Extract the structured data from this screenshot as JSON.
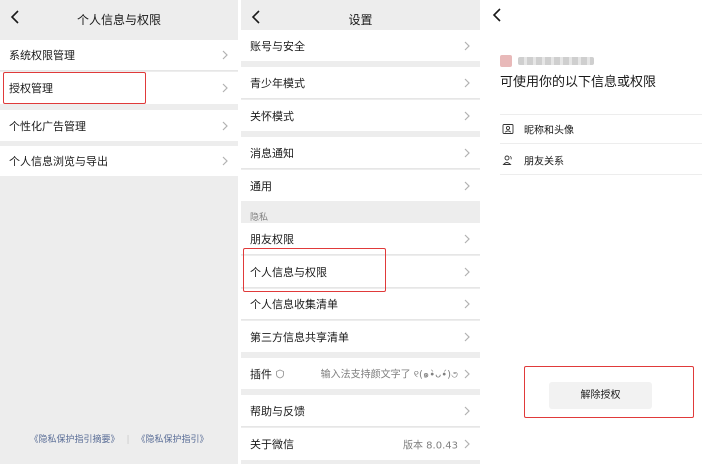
{
  "panel1": {
    "title": "个人信息与权限",
    "items": [
      {
        "label": "系统权限管理"
      },
      {
        "label": "授权管理"
      },
      {
        "label": "个性化广告管理"
      },
      {
        "label": "个人信息浏览与导出"
      }
    ],
    "footer_links": [
      "《隐私保护指引摘要》",
      "《隐私保护指引》"
    ]
  },
  "panel2": {
    "title": "设置",
    "items": [
      {
        "label": "账号与安全"
      },
      {
        "label": "青少年模式"
      },
      {
        "label": "关怀模式"
      },
      {
        "label": "消息通知"
      },
      {
        "label": "通用"
      },
      {
        "label": "朋友权限"
      },
      {
        "label": "个人信息与权限"
      },
      {
        "label": "个人信息收集清单"
      },
      {
        "label": "第三方信息共享清单"
      },
      {
        "label": "插件",
        "value": "输入法支持颜文字了 ୧(๑•̀ᴗ•́)૭"
      },
      {
        "label": "帮助与反馈"
      },
      {
        "label": "关于微信",
        "value": "版本 8.0.43"
      }
    ],
    "section_label": "隐私"
  },
  "panel3": {
    "heading": "可使用你的以下信息或权限",
    "permissions": [
      {
        "label": "昵称和头像",
        "icon": "id-card-icon"
      },
      {
        "label": "朋友关系",
        "icon": "friends-icon"
      }
    ],
    "revoke_label": "解除授权"
  },
  "colors": {
    "highlight": "#e03a3a",
    "link": "#576b95",
    "panel_bg": "#ededed"
  }
}
